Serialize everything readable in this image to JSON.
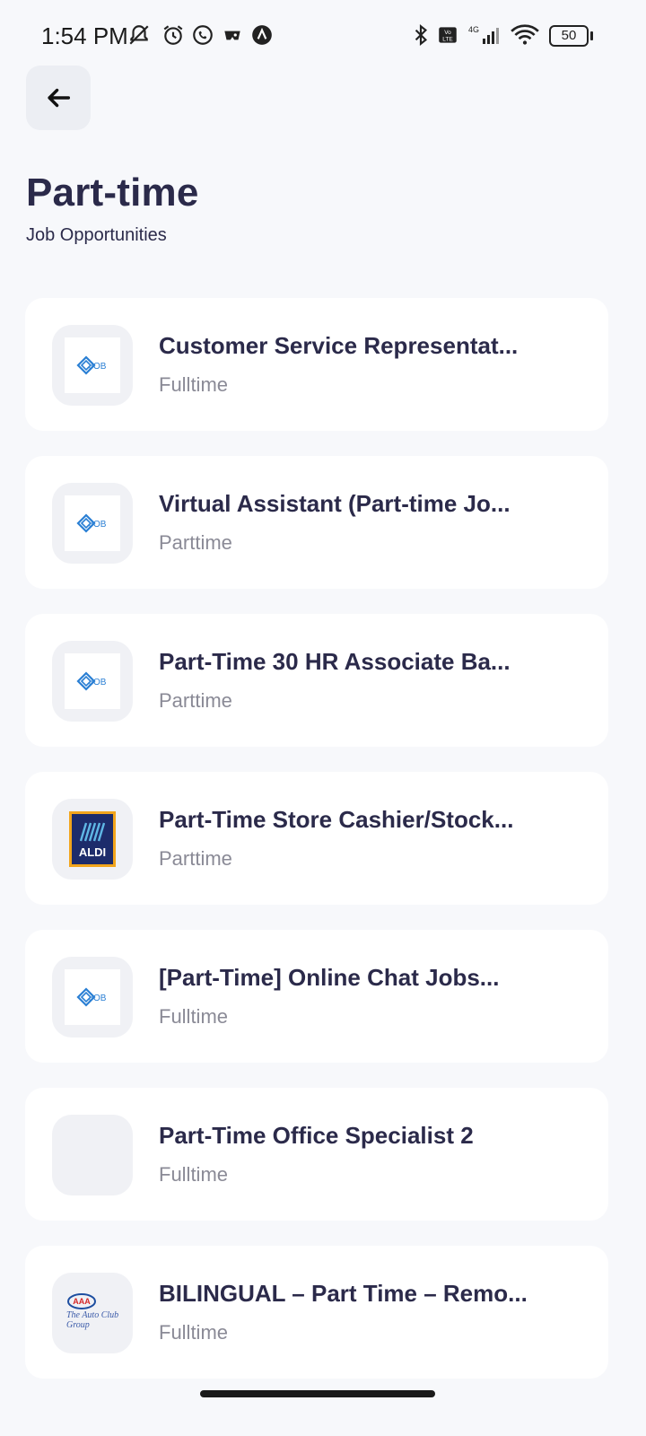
{
  "status_bar": {
    "time": "1:54 PM",
    "battery_level": "50",
    "network": "4G",
    "volte": "Vo LTE"
  },
  "header": {
    "back_icon": "arrow-left-icon",
    "title": "Part-time",
    "subtitle": "Job Opportunities"
  },
  "jobs": [
    {
      "title": "Customer Service Representat...",
      "type": "Fulltime",
      "logo": "job-logo"
    },
    {
      "title": "Virtual Assistant (Part-time Jo...",
      "type": "Parttime",
      "logo": "job-logo"
    },
    {
      "title": "Part-Time 30 HR Associate Ba...",
      "type": "Parttime",
      "logo": "job-logo"
    },
    {
      "title": "Part-Time Store Cashier/Stock...",
      "type": "Parttime",
      "logo": "aldi-logo",
      "logo_text": "ALDI"
    },
    {
      "title": "[Part-Time] Online Chat Jobs...",
      "type": "Fulltime",
      "logo": "job-logo"
    },
    {
      "title": "Part-Time Office Specialist 2",
      "type": "Fulltime",
      "logo": "blank"
    },
    {
      "title": "BILINGUAL – Part Time – Remo...",
      "type": "Fulltime",
      "logo": "aaa-logo",
      "logo_text": "The Auto Club Group"
    }
  ],
  "colors": {
    "background": "#f7f8fb",
    "card": "#ffffff",
    "title_text": "#2b2a4a",
    "muted_text": "#8a8a96",
    "job_logo_blue": "#2a7fd4"
  }
}
